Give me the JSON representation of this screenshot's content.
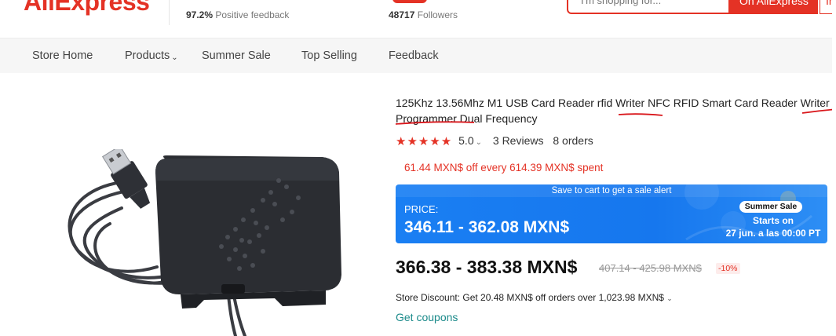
{
  "header": {
    "logo": "AliExpress",
    "feedback_percent": "97.2%",
    "feedback_label": " Positive feedback",
    "followers_count": "48717",
    "followers_label": " Followers",
    "search_placeholder": "I'm shopping for...",
    "search_button": "On AliExpress",
    "search_button2": "In"
  },
  "nav": {
    "items": [
      "Store Home",
      "Products",
      "Summer Sale",
      "Top Selling",
      "Feedback"
    ]
  },
  "product": {
    "title": "125Khz 13.56Mhz M1 USB Card Reader rfid Writer NFC RFID Smart Card Reader Writer Programmer Dual Frequency",
    "rating": "5.0",
    "reviews": "3 Reviews",
    "orders": "8 orders",
    "coupon_text": "61.44 MXN$ off every 614.39 MXN$ spent",
    "banner_tip": "Save to cart to get a sale alert",
    "price_label": "PRICE:",
    "sale_price": "346.11 - 362.08 MXN$",
    "sale_badge": "Summer Sale",
    "starts_on": "Starts on",
    "starts_date": "27 jun. a las 00:00 PT",
    "current_price": "366.38 - 383.38 MXN$",
    "original_price": "407.14 - 425.98 MXN$",
    "discount": "-10%",
    "store_discount": "Store Discount: Get 20.48 MXN$ off orders over 1,023.98 MXN$",
    "get_coupons": "Get coupons",
    "stars": 5
  },
  "colors": {
    "brand_red": "#e43225",
    "banner_blue": "#1677ee",
    "link_teal": "#1b8a8a"
  }
}
